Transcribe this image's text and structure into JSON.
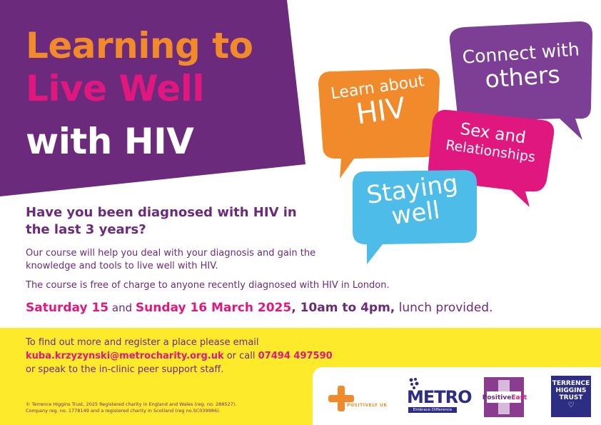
{
  "title": {
    "line1": "Learning to",
    "line2": "Live Well",
    "line3": "with HIV"
  },
  "bubbles": {
    "learn_line1": "Learn about",
    "learn_line2": "HIV",
    "connect_line1": "Connect with",
    "connect_line2": "others",
    "sex_line1": "Sex and",
    "sex_line2": "Relationships",
    "staying_line1": "Staying",
    "staying_line2": "well"
  },
  "question": "Have you been diagnosed with HIV in the last 3 years?",
  "intro": "Our course will help you deal with your diagnosis and gain the knowledge and tools to live well with HIV.",
  "free": "The course is free of charge to anyone recently diagnosed with HIV in London.",
  "dates": {
    "day1": "Saturday 15",
    "and": " and ",
    "day2": "Sunday 16 March 2025",
    "time": ", 10am to 4pm,",
    "lunch": " lunch provided."
  },
  "contact": {
    "line1": "To find out more and register a place please email",
    "email": "kuba.krzyzynski@metrocharity.org.uk",
    "or_call": " or call ",
    "phone": "07494 497590",
    "line3": "or speak to the in-clinic peer support staff."
  },
  "legal": {
    "line1": "© Terrence Higgins Trust, 2025 Registered charity in England and Wales (reg. no. 288527).",
    "line2": "Company reg. no. 1778149 and a registered charity in Scotland (reg no.SC039986)."
  },
  "logos": {
    "positively_uk": "POSITIVELY UK",
    "metro": "METRO",
    "metro_tagline": "Embrace Difference",
    "positive_east_a": "Positive",
    "positive_east_b": "East",
    "tht_line1": "TERRENCE",
    "tht_line2": "HIGGINS",
    "tht_line3": "TRUST"
  },
  "colors": {
    "purple": "#6c2a7c",
    "orange": "#f18a2b",
    "pink": "#e0177e",
    "blue": "#4dbce9",
    "violet": "#7d3f95",
    "yellow": "#fdea2a",
    "navy": "#2d2e83"
  }
}
